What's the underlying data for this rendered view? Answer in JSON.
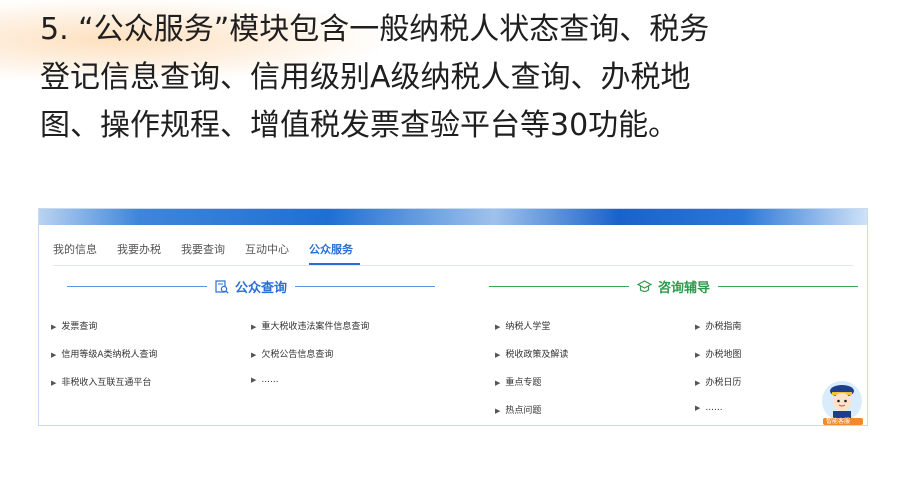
{
  "heading": {
    "lines": [
      "5. “公众服务”模块包含一般纳税人状态查询、税务",
      "登记信息查询、信用级别A级纳税人查询、办税地",
      "图、操作规程、增值税发票查验平台等30功能。"
    ]
  },
  "tabs": [
    "我的信息",
    "我要办税",
    "我要查询",
    "互动中心",
    "公众服务"
  ],
  "sections": {
    "public_query": {
      "title": "公众查询",
      "icon": "search-document-icon",
      "links": [
        "发票查询",
        "重大税收违法案件信息查询",
        "信用等级A类纳税人查询",
        "欠税公告信息查询",
        "非税收入互联互通平台",
        "......"
      ]
    },
    "consult": {
      "title": "咨询辅导",
      "icon": "graduation-cap-icon",
      "links": [
        "纳税人学堂",
        "办税指南",
        "税收政策及解读",
        "办税地图",
        "重点专题",
        "办税日历",
        "热点问题",
        "......"
      ]
    }
  },
  "mascot": {
    "label": "智能客服"
  },
  "colors": {
    "accent_blue": "#2b6fd6",
    "accent_green": "#2e9a4b",
    "highlight": "#fdd6aa"
  }
}
